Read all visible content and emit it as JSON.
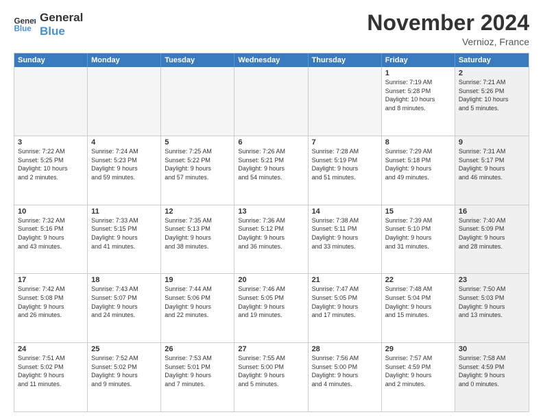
{
  "logo": {
    "line1": "General",
    "line2": "Blue"
  },
  "title": "November 2024",
  "location": "Vernioz, France",
  "header_days": [
    "Sunday",
    "Monday",
    "Tuesday",
    "Wednesday",
    "Thursday",
    "Friday",
    "Saturday"
  ],
  "rows": [
    [
      {
        "day": "",
        "info": "",
        "empty": true
      },
      {
        "day": "",
        "info": "",
        "empty": true
      },
      {
        "day": "",
        "info": "",
        "empty": true
      },
      {
        "day": "",
        "info": "",
        "empty": true
      },
      {
        "day": "",
        "info": "",
        "empty": true
      },
      {
        "day": "1",
        "info": "Sunrise: 7:19 AM\nSunset: 5:28 PM\nDaylight: 10 hours\nand 8 minutes.",
        "empty": false,
        "shaded": false
      },
      {
        "day": "2",
        "info": "Sunrise: 7:21 AM\nSunset: 5:26 PM\nDaylight: 10 hours\nand 5 minutes.",
        "empty": false,
        "shaded": true
      }
    ],
    [
      {
        "day": "3",
        "info": "Sunrise: 7:22 AM\nSunset: 5:25 PM\nDaylight: 10 hours\nand 2 minutes.",
        "empty": false,
        "shaded": false
      },
      {
        "day": "4",
        "info": "Sunrise: 7:24 AM\nSunset: 5:23 PM\nDaylight: 9 hours\nand 59 minutes.",
        "empty": false,
        "shaded": false
      },
      {
        "day": "5",
        "info": "Sunrise: 7:25 AM\nSunset: 5:22 PM\nDaylight: 9 hours\nand 57 minutes.",
        "empty": false,
        "shaded": false
      },
      {
        "day": "6",
        "info": "Sunrise: 7:26 AM\nSunset: 5:21 PM\nDaylight: 9 hours\nand 54 minutes.",
        "empty": false,
        "shaded": false
      },
      {
        "day": "7",
        "info": "Sunrise: 7:28 AM\nSunset: 5:19 PM\nDaylight: 9 hours\nand 51 minutes.",
        "empty": false,
        "shaded": false
      },
      {
        "day": "8",
        "info": "Sunrise: 7:29 AM\nSunset: 5:18 PM\nDaylight: 9 hours\nand 49 minutes.",
        "empty": false,
        "shaded": false
      },
      {
        "day": "9",
        "info": "Sunrise: 7:31 AM\nSunset: 5:17 PM\nDaylight: 9 hours\nand 46 minutes.",
        "empty": false,
        "shaded": true
      }
    ],
    [
      {
        "day": "10",
        "info": "Sunrise: 7:32 AM\nSunset: 5:16 PM\nDaylight: 9 hours\nand 43 minutes.",
        "empty": false,
        "shaded": false
      },
      {
        "day": "11",
        "info": "Sunrise: 7:33 AM\nSunset: 5:15 PM\nDaylight: 9 hours\nand 41 minutes.",
        "empty": false,
        "shaded": false
      },
      {
        "day": "12",
        "info": "Sunrise: 7:35 AM\nSunset: 5:13 PM\nDaylight: 9 hours\nand 38 minutes.",
        "empty": false,
        "shaded": false
      },
      {
        "day": "13",
        "info": "Sunrise: 7:36 AM\nSunset: 5:12 PM\nDaylight: 9 hours\nand 36 minutes.",
        "empty": false,
        "shaded": false
      },
      {
        "day": "14",
        "info": "Sunrise: 7:38 AM\nSunset: 5:11 PM\nDaylight: 9 hours\nand 33 minutes.",
        "empty": false,
        "shaded": false
      },
      {
        "day": "15",
        "info": "Sunrise: 7:39 AM\nSunset: 5:10 PM\nDaylight: 9 hours\nand 31 minutes.",
        "empty": false,
        "shaded": false
      },
      {
        "day": "16",
        "info": "Sunrise: 7:40 AM\nSunset: 5:09 PM\nDaylight: 9 hours\nand 28 minutes.",
        "empty": false,
        "shaded": true
      }
    ],
    [
      {
        "day": "17",
        "info": "Sunrise: 7:42 AM\nSunset: 5:08 PM\nDaylight: 9 hours\nand 26 minutes.",
        "empty": false,
        "shaded": false
      },
      {
        "day": "18",
        "info": "Sunrise: 7:43 AM\nSunset: 5:07 PM\nDaylight: 9 hours\nand 24 minutes.",
        "empty": false,
        "shaded": false
      },
      {
        "day": "19",
        "info": "Sunrise: 7:44 AM\nSunset: 5:06 PM\nDaylight: 9 hours\nand 22 minutes.",
        "empty": false,
        "shaded": false
      },
      {
        "day": "20",
        "info": "Sunrise: 7:46 AM\nSunset: 5:05 PM\nDaylight: 9 hours\nand 19 minutes.",
        "empty": false,
        "shaded": false
      },
      {
        "day": "21",
        "info": "Sunrise: 7:47 AM\nSunset: 5:05 PM\nDaylight: 9 hours\nand 17 minutes.",
        "empty": false,
        "shaded": false
      },
      {
        "day": "22",
        "info": "Sunrise: 7:48 AM\nSunset: 5:04 PM\nDaylight: 9 hours\nand 15 minutes.",
        "empty": false,
        "shaded": false
      },
      {
        "day": "23",
        "info": "Sunrise: 7:50 AM\nSunset: 5:03 PM\nDaylight: 9 hours\nand 13 minutes.",
        "empty": false,
        "shaded": true
      }
    ],
    [
      {
        "day": "24",
        "info": "Sunrise: 7:51 AM\nSunset: 5:02 PM\nDaylight: 9 hours\nand 11 minutes.",
        "empty": false,
        "shaded": false
      },
      {
        "day": "25",
        "info": "Sunrise: 7:52 AM\nSunset: 5:02 PM\nDaylight: 9 hours\nand 9 minutes.",
        "empty": false,
        "shaded": false
      },
      {
        "day": "26",
        "info": "Sunrise: 7:53 AM\nSunset: 5:01 PM\nDaylight: 9 hours\nand 7 minutes.",
        "empty": false,
        "shaded": false
      },
      {
        "day": "27",
        "info": "Sunrise: 7:55 AM\nSunset: 5:00 PM\nDaylight: 9 hours\nand 5 minutes.",
        "empty": false,
        "shaded": false
      },
      {
        "day": "28",
        "info": "Sunrise: 7:56 AM\nSunset: 5:00 PM\nDaylight: 9 hours\nand 4 minutes.",
        "empty": false,
        "shaded": false
      },
      {
        "day": "29",
        "info": "Sunrise: 7:57 AM\nSunset: 4:59 PM\nDaylight: 9 hours\nand 2 minutes.",
        "empty": false,
        "shaded": false
      },
      {
        "day": "30",
        "info": "Sunrise: 7:58 AM\nSunset: 4:59 PM\nDaylight: 9 hours\nand 0 minutes.",
        "empty": false,
        "shaded": true
      }
    ]
  ]
}
